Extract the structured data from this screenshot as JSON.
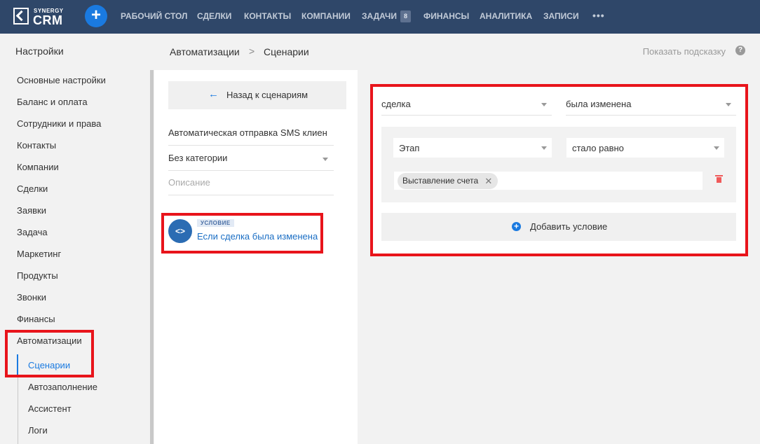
{
  "brand": {
    "top": "SYNERGY",
    "main": "CRM"
  },
  "colors": {
    "nav_bg": "#2f4769",
    "accent": "#1a7ae0",
    "highlight": "#e8141b",
    "delete": "#f05a5a"
  },
  "nav": {
    "items": [
      "РАБОЧИЙ СТОЛ",
      "СДЕЛКИ",
      "КОНТАКТЫ",
      "КОМПАНИИ",
      "ЗАДАЧИ",
      "ФИНАНСЫ",
      "АНАЛИТИКА",
      "ЗАПИСИ"
    ],
    "tasks_badge": "8",
    "more": "•••",
    "add": "+"
  },
  "sidebar": {
    "title": "Настройки",
    "items": [
      "Основные настройки",
      "Баланс и оплата",
      "Сотрудники и права",
      "Контакты",
      "Компании",
      "Сделки",
      "Заявки",
      "Задача",
      "Маркетинг",
      "Продукты",
      "Звонки",
      "Финансы",
      "Автоматизации"
    ],
    "sub_items": [
      "Сценарии",
      "Автозаполнение",
      "Ассистент",
      "Логи"
    ],
    "active_sub": "Сценарии"
  },
  "header": {
    "breadcrumb": [
      "Автоматизации",
      "Сценарии"
    ],
    "separator": ">",
    "hint": "Показать подсказку",
    "help": "?"
  },
  "scenario": {
    "back_arrow": "←",
    "back_label": "Назад к сценариям",
    "name": "Автоматическая отправка SMS клиен",
    "category": "Без категории",
    "description_placeholder": "Описание",
    "condition_icon": "<>",
    "condition_tag": "УСЛОВИЕ",
    "condition_label": "Если сделка была изменена"
  },
  "condition_editor": {
    "entity": "сделка",
    "event": "была изменена",
    "field": "Этап",
    "operator": "стало равно",
    "value_chip": "Выставление счета",
    "chip_remove": "✕",
    "add_icon": "+",
    "add_label": "Добавить условие"
  }
}
